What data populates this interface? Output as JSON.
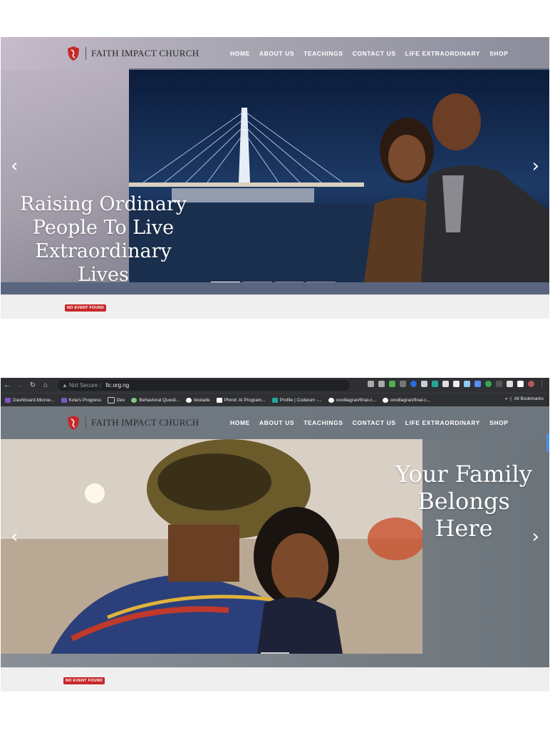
{
  "brand": {
    "name": "FAITH IMPACT CHURCH",
    "primary_red": "#c62828"
  },
  "nav": {
    "items": [
      "HOME",
      "ABOUT US",
      "TEACHINGS",
      "CONTACT US",
      "LIFE EXTRAORDINARY",
      "SHOP"
    ]
  },
  "slide1": {
    "line1": "Raising Ordinary",
    "line2": "People To Live",
    "line3": "Extraordinary Lives"
  },
  "slide2": {
    "line1": "Your Family",
    "line2": "Belongs Here"
  },
  "events": {
    "badge": "NO EVENT FOUND"
  },
  "arrows": {
    "prev": "‹",
    "next": "›"
  },
  "browser": {
    "security": "Not Secure",
    "host": "fic.org.ng",
    "bookmarks": [
      "Dashboard.Microe...",
      "Kola's Progress",
      "Dev",
      "Behavioral Questi...",
      "kkolade",
      "Phind: AI Program...",
      "Profile | Codeium -...",
      "oovillagran/final-c...",
      "oovillagran/final-c..."
    ],
    "all_bookmarks": "All Bookmarks",
    "overflow": "»"
  }
}
